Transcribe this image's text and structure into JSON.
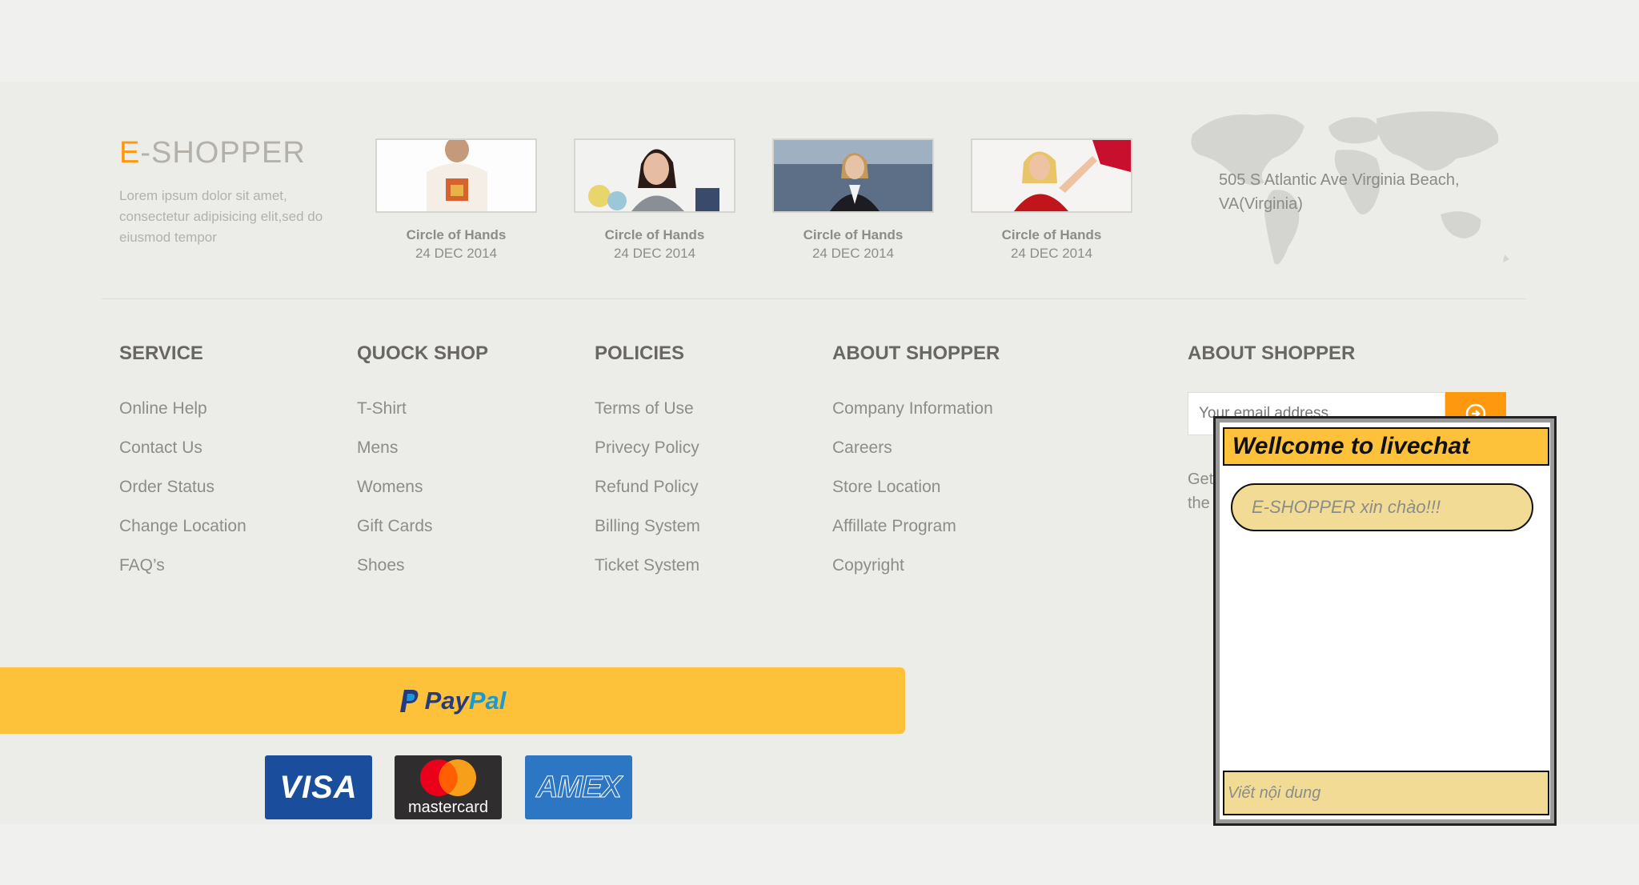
{
  "brand": {
    "logo_accent": "E",
    "logo_rest": "-SHOPPER",
    "description": "Lorem ipsum dolor sit amet, consectetur adipisicing elit,sed do eiusmod tempor",
    "accent_color": "#fe980f"
  },
  "videos": [
    {
      "title": "Circle of Hands",
      "date": "24 DEC 2014"
    },
    {
      "title": "Circle of Hands",
      "date": "24 DEC 2014"
    },
    {
      "title": "Circle of Hands",
      "date": "24 DEC 2014"
    },
    {
      "title": "Circle of Hands",
      "date": "24 DEC 2014"
    }
  ],
  "address": "505 S Atlantic Ave Virginia Beach, VA(Virginia)",
  "columns": [
    {
      "title": "SERVICE",
      "links": [
        "Online Help",
        "Contact Us",
        "Order Status",
        "Change Location",
        "FAQ’s"
      ]
    },
    {
      "title": "QUOCK SHOP",
      "links": [
        "T-Shirt",
        "Mens",
        "Womens",
        "Gift Cards",
        "Shoes"
      ]
    },
    {
      "title": "POLICIES",
      "links": [
        "Terms of Use",
        "Privecy Policy",
        "Refund Policy",
        "Billing System",
        "Ticket System"
      ]
    },
    {
      "title": "ABOUT SHOPPER",
      "links": [
        "Company Information",
        "Careers",
        "Store Location",
        "Affillate Program",
        "Copyright"
      ]
    }
  ],
  "newsletter": {
    "title": "ABOUT SHOPPER",
    "email_placeholder": "Your email address",
    "text": "Get the most recent updates from our site and be updated your self..."
  },
  "payment": {
    "paypal_pay": "Pay",
    "paypal_pal": "Pal",
    "visa": "VISA",
    "mastercard": "mastercard",
    "amex": "AMEX"
  },
  "livechat": {
    "title": "Wellcome to livechat",
    "greeting": "E-SHOPPER xin chào!!!",
    "input_placeholder": "Viết nội dung",
    "header_color": "#fec23a",
    "bubble_color": "#f2dc95"
  }
}
